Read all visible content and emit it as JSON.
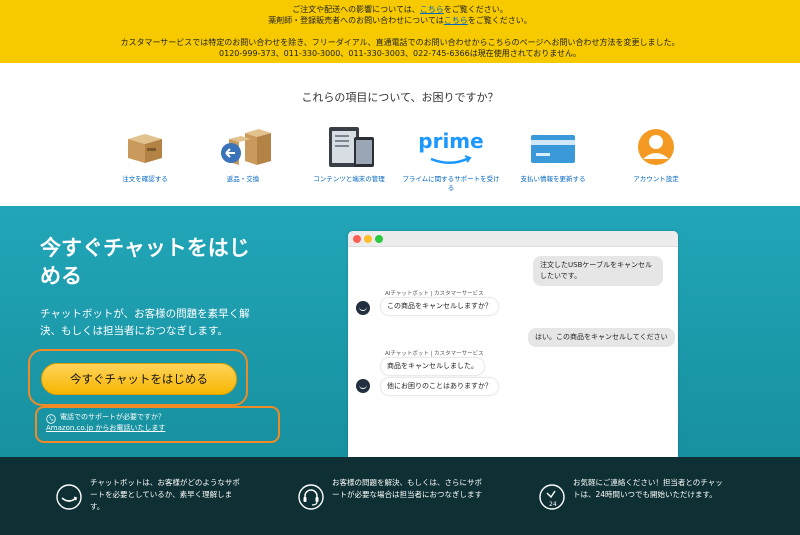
{
  "banner": {
    "line1_pre": "ご注文や配送への影響については、",
    "line1_link": "こちら",
    "line1_post": "をご覧ください。",
    "line2_pre": "薬剤師・登録販売者へのお問い合わせについては",
    "line2_link": "こちら",
    "line2_post": "をご覧ください。",
    "line3": "カスタマーサービスでは特定のお問い合わせを除き、フリーダイアル、直通電話でのお問い合わせからこちらのページへお問い合わせ方法を変更しました。",
    "line4": "0120-999-373、011-330-3000、011-330-3003、022-745-6366は現在使用されておりません。"
  },
  "categories": {
    "title": "これらの項目について、お困りですか？",
    "items": [
      {
        "label": "注文を確認する",
        "icon": "package-icon"
      },
      {
        "label": "返品・交換",
        "icon": "return-box-icon"
      },
      {
        "label": "コンテンツと端末の管理",
        "icon": "devices-icon"
      },
      {
        "label": "プライムに関するサポートを受ける",
        "icon": "prime-logo-icon",
        "logo_text": "prime"
      },
      {
        "label": "支払い情報を更新する",
        "icon": "credit-card-icon"
      },
      {
        "label": "アカウント設定",
        "icon": "account-icon"
      }
    ]
  },
  "hero": {
    "title": "今すぐチャットをはじめる",
    "description": "チャットボットが、お客様の問題を素早く解決、もしくは担当者におつなぎします。",
    "cta_label": "今すぐチャットをはじめる",
    "phone_prefix": "電話でのサポートが必要ですか？",
    "phone_link": "Amazon.co.jp からお電話いたします"
  },
  "chat": {
    "messages": [
      {
        "from": "user",
        "text": "注文したUSBケーブルをキャンセルしたいです。"
      },
      {
        "from": "bot",
        "label": "AIチャットボット | カスタマーサービス",
        "texts": [
          "この商品をキャンセルしますか？"
        ]
      },
      {
        "from": "user",
        "text": "はい。この商品をキャンセルしてください"
      },
      {
        "from": "bot",
        "label": "AIチャットボット | カスタマーサービス",
        "texts": [
          "商品をキャンセルしました。",
          "他にお困りのことはありますか？"
        ]
      }
    ]
  },
  "features": [
    {
      "icon": "smile-icon",
      "text": "チャットボットは、お客様がどのようなサポートを必要としているか、素早く理解します。"
    },
    {
      "icon": "headset-icon",
      "text": "お客様の問題を解決、もしくは、さらにサポートが必要な場合は担当者におつなぎします"
    },
    {
      "icon": "clock-24-icon",
      "text": "お気軽にご連絡ください！担当者とのチャットは、24時間いつでも開始いただけます。"
    }
  ],
  "colors": {
    "banner": "#f7ca00",
    "teal": "#1a9aab",
    "dark": "#0e2f33",
    "cta": "#f7b600",
    "highlight": "#f08a24",
    "link": "#0066c0"
  }
}
